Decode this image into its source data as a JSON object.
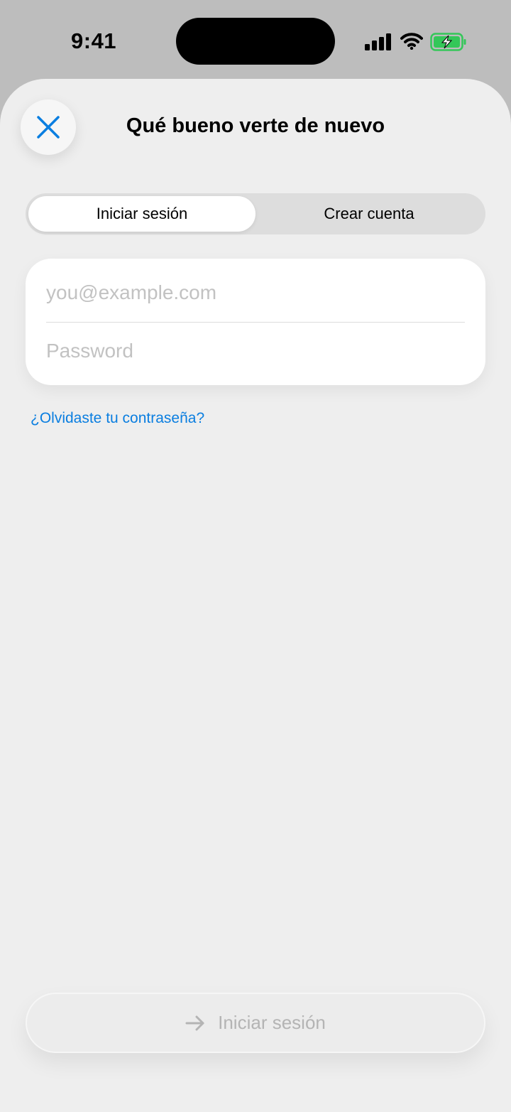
{
  "status_bar": {
    "time": "9:41",
    "icons": [
      "signal-icon",
      "wifi-icon",
      "battery-charging-icon"
    ],
    "battery_color": "#34c759"
  },
  "sheet": {
    "title": "Qué bueno verte de nuevo",
    "close_icon": "close-icon"
  },
  "tabs": [
    {
      "label": "Iniciar sesión",
      "selected": true
    },
    {
      "label": "Crear cuenta",
      "selected": false
    }
  ],
  "form": {
    "email": {
      "value": "",
      "placeholder": "you@example.com"
    },
    "password": {
      "value": "",
      "placeholder": "Password"
    }
  },
  "forgot_password_label": "¿Olvidaste tu contraseña?",
  "submit": {
    "label": "Iniciar sesión",
    "icon": "arrow-right-icon",
    "enabled": false
  },
  "colors": {
    "accent": "#0a7ee0",
    "sheet_background": "#eeeeee",
    "disabled_text": "#b4b4b4"
  }
}
